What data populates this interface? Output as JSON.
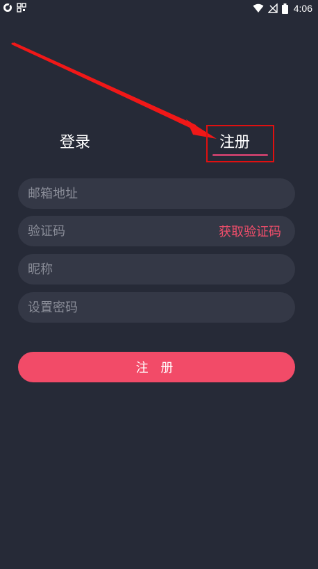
{
  "status_bar": {
    "time": "4:06"
  },
  "tabs": {
    "login_label": "登录",
    "register_label": "注册"
  },
  "form": {
    "email_placeholder": "邮箱地址",
    "code_placeholder": "验证码",
    "get_code_label": "获取验证码",
    "nickname_placeholder": "昵称",
    "password_placeholder": "设置密码"
  },
  "submit": {
    "label": "注 册"
  },
  "colors": {
    "background": "#262a37",
    "field_background": "#343846",
    "accent": "#f24b68",
    "annotation_red": "#e01010"
  },
  "icons": {
    "status_left": [
      "sync-icon",
      "qr-icon"
    ],
    "status_right": [
      "wifi-icon",
      "no-signal-icon",
      "battery-icon"
    ]
  }
}
